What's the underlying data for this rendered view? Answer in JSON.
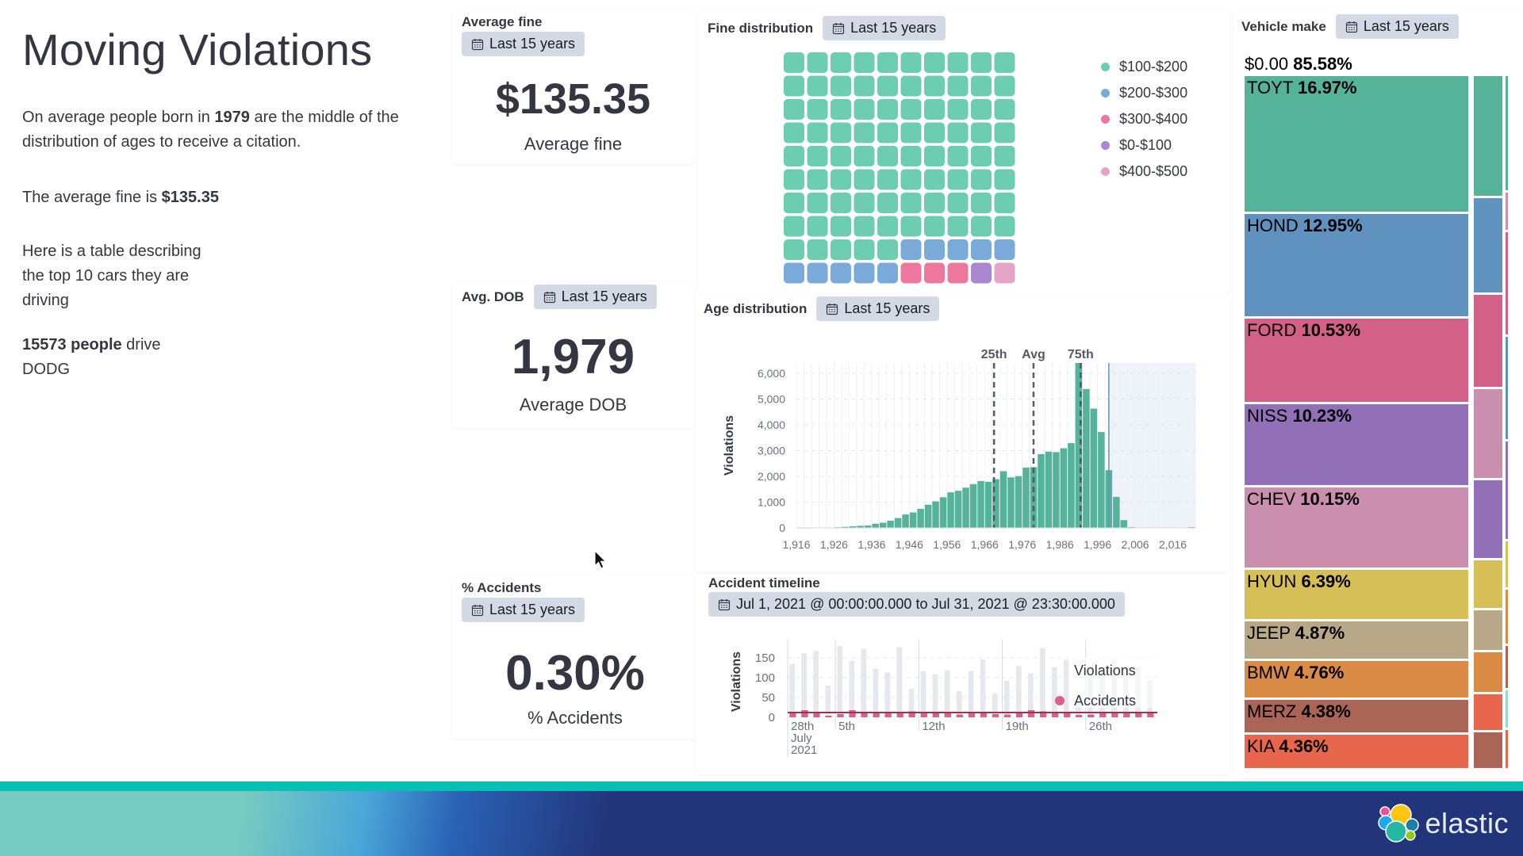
{
  "page": {
    "title": "Moving Violations",
    "intro": {
      "pre": "On average people born in ",
      "year": "1979",
      "post": " are the middle of the distribution of ages to receive a citation."
    },
    "avg_fine_text": {
      "pre": "The average fine is ",
      "value": "$135.35"
    },
    "table_text": [
      "Here is a table describing",
      "the top 10 cars they are",
      "driving"
    ],
    "drivers_text": {
      "count": "15573 people",
      "mid": " drive",
      "make": "DODG"
    }
  },
  "time_badge": "Last 15 years",
  "metrics": {
    "avg_fine": {
      "title": "Average fine",
      "value": "$135.35",
      "label": "Average fine"
    },
    "avg_dob": {
      "title": "Avg. DOB",
      "value": "1,979",
      "label": "Average DOB"
    },
    "pct_accidents": {
      "title": "% Accidents",
      "value": "0.30%",
      "label": "% Accidents"
    }
  },
  "panels": {
    "fine_distribution": {
      "title": "Fine distribution"
    },
    "age_distribution": {
      "title": "Age distribution"
    },
    "accident_timeline": {
      "title": "Accident timeline",
      "range": "Jul 1, 2021 @ 00:00:00.000 to Jul 31, 2021 @ 23:30:00.000"
    },
    "vehicle_make": {
      "title": "Vehicle make"
    }
  },
  "footer": {
    "brand": "elastic"
  },
  "colors": {
    "green": "#6dcdb0",
    "blue": "#79aad9",
    "pink": "#ee789d",
    "purple": "#a987d1",
    "light_pink": "#e4a6c7",
    "bar": "#54b399",
    "accent_teal": "#07c0b4",
    "footer_navy": "#22347a"
  },
  "chart_data": [
    {
      "type": "waffle",
      "title": "Fine distribution",
      "units": "percent of violations (1 cell = 1%)",
      "legend_position": "right",
      "categories": [
        "$100-$200",
        "$200-$300",
        "$300-$400",
        "$0-$100",
        "$400-$500"
      ],
      "values": [
        85,
        10,
        3,
        1,
        1
      ],
      "colors": [
        "#6dcdb0",
        "#79aad9",
        "#ee789d",
        "#a987d1",
        "#e4a6c7"
      ]
    },
    {
      "type": "bar",
      "title": "Age distribution",
      "xlabel": "",
      "ylabel": "Violations",
      "bucket_years": 2,
      "x": [
        1916,
        1918,
        1920,
        1922,
        1924,
        1926,
        1928,
        1930,
        1932,
        1934,
        1936,
        1938,
        1940,
        1942,
        1944,
        1946,
        1948,
        1950,
        1952,
        1954,
        1956,
        1958,
        1960,
        1962,
        1964,
        1966,
        1968,
        1970,
        1972,
        1974,
        1976,
        1978,
        1980,
        1982,
        1984,
        1986,
        1988,
        1990,
        1992,
        1994,
        1996,
        1998,
        2000,
        2002,
        2004,
        2006,
        2008,
        2010,
        2012,
        2014,
        2016,
        2018,
        2020
      ],
      "values": [
        0,
        0,
        5,
        10,
        15,
        25,
        40,
        60,
        80,
        90,
        160,
        200,
        280,
        380,
        520,
        600,
        740,
        900,
        1030,
        1190,
        1380,
        1440,
        1560,
        1700,
        1820,
        1790,
        1890,
        2200,
        1960,
        2010,
        2340,
        2360,
        2860,
        2960,
        2940,
        3090,
        3290,
        6400,
        5390,
        4630,
        3720,
        2240,
        1200,
        300,
        30,
        10,
        5,
        5,
        5,
        5,
        5,
        5,
        30
      ],
      "xticks": [
        "1,916",
        "1,926",
        "1,936",
        "1,946",
        "1,956",
        "1,966",
        "1,976",
        "1,986",
        "1,996",
        "2,006",
        "2,016"
      ],
      "yticks": [
        "0",
        "1,000",
        "2,000",
        "3,000",
        "4,000",
        "5,000",
        "6,000"
      ],
      "ylim": [
        0,
        6400
      ],
      "xlim": [
        1916,
        2022
      ],
      "annotations": [
        {
          "label": "25th",
          "x": 1968.5
        },
        {
          "label": "Avg",
          "x": 1979
        },
        {
          "label": "75th",
          "x": 1991.5
        }
      ],
      "highlight_after": 1999,
      "grid": true
    },
    {
      "type": "bar",
      "title": "Accident timeline",
      "ylabel": "Violations",
      "legend_position": "right",
      "legend": [
        "Violations",
        "Accidents"
      ],
      "days": [
        "Jul 1",
        "Jul 2",
        "Jul 3",
        "Jul 4",
        "Jul 5",
        "Jul 6",
        "Jul 7",
        "Jul 8",
        "Jul 9",
        "Jul 10",
        "Jul 11",
        "Jul 12",
        "Jul 13",
        "Jul 14",
        "Jul 15",
        "Jul 16",
        "Jul 17",
        "Jul 18",
        "Jul 19",
        "Jul 20",
        "Jul 21",
        "Jul 22",
        "Jul 23",
        "Jul 24",
        "Jul 25",
        "Jul 26",
        "Jul 27",
        "Jul 28",
        "Jul 29",
        "Jul 30",
        "Jul 31"
      ],
      "series": [
        {
          "name": "Violations",
          "values": [
            135,
            162,
            167,
            80,
            180,
            142,
            173,
            123,
            113,
            177,
            72,
            116,
            109,
            119,
            66,
            117,
            146,
            60,
            92,
            130,
            111,
            175,
            127,
            145,
            40,
            130,
            125,
            145,
            130,
            128,
            95
          ]
        },
        {
          "name": "Accidents",
          "values": [
            12,
            18,
            10,
            4,
            8,
            18,
            14,
            13,
            13,
            14,
            15,
            10,
            12,
            10,
            7,
            12,
            14,
            8,
            7,
            13,
            18,
            15,
            12,
            10,
            6,
            7,
            12,
            12,
            13,
            12,
            12
          ]
        }
      ],
      "xticks": [
        "28th",
        "5th",
        "12th",
        "19th",
        "26th"
      ],
      "xtick_sub": [
        "July",
        "2021"
      ],
      "yticks": [
        "0",
        "50",
        "100",
        "150"
      ],
      "ylim": [
        0,
        180
      ],
      "reference_line": 12
    },
    {
      "type": "treemap",
      "title": "Vehicle make",
      "parent": {
        "label": "$0.00",
        "value": "85.58%"
      },
      "categories": [
        "TOYT",
        "HOND",
        "FORD",
        "NISS",
        "CHEV",
        "HYUN",
        "JEEP",
        "BMW",
        "MERZ",
        "KIA"
      ],
      "values": [
        16.97,
        12.95,
        10.53,
        10.23,
        10.15,
        6.39,
        4.87,
        4.76,
        4.38,
        4.36
      ],
      "labels": [
        "16.97%",
        "12.95%",
        "10.53%",
        "10.23%",
        "10.15%",
        "6.39%",
        "4.87%",
        "4.76%",
        "4.38%",
        "4.36%"
      ],
      "colors": [
        "#54b399",
        "#6092c0",
        "#d36086",
        "#9170b8",
        "#ca8eae",
        "#d6bf57",
        "#b9a888",
        "#da8b45",
        "#aa6556",
        "#e7664c"
      ]
    }
  ]
}
